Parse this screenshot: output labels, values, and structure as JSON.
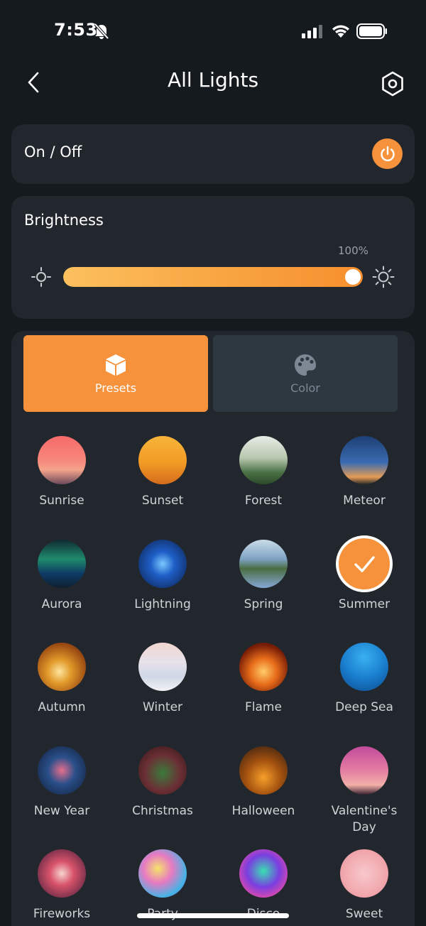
{
  "status": {
    "time": "7:53"
  },
  "nav": {
    "title": "All Lights"
  },
  "power": {
    "label": "On / Off"
  },
  "brightness": {
    "title": "Brightness",
    "percent_label": "100%",
    "level": 1.0
  },
  "tabs": [
    {
      "label": "Presets",
      "active": true
    },
    {
      "label": "Color",
      "active": false
    }
  ],
  "scenes": [
    {
      "label": "Sunrise",
      "bg": "linear-gradient(180deg,#f66b6b 0%,#f7877c 50%,#f4a48a 70%,#6b4a5b 100%)"
    },
    {
      "label": "Sunset",
      "bg": "linear-gradient(180deg,#f6b53a 0%,#f29b25 55%,#d56c1c 100%)"
    },
    {
      "label": "Forest",
      "bg": "linear-gradient(180deg,#e7ece6 0%,#b9c8b0 45%,#4c7246 75%,#2c4a2a 100%)"
    },
    {
      "label": "Meteor",
      "bg": "linear-gradient(180deg,#1e3f74 0%,#3a6bb1 55%,#e59b55 85%,#2a2a2a 100%)"
    },
    {
      "label": "Aurora",
      "bg": "linear-gradient(180deg,#0f2b33 0%,#1f8a6c 40%,#0d3a64 70%,#102030 100%)"
    },
    {
      "label": "Lightning",
      "bg": "radial-gradient(circle,#7ac9ff 0%,#1f5fc8 35%,#0b1c44 100%)"
    },
    {
      "label": "Spring",
      "bg": "linear-gradient(180deg,#c9dbe8 0%,#7fa3c4 40%,#4a6d42 60%,#86a8d8 100%)"
    },
    {
      "label": "Summer",
      "bg": "#f7923c",
      "selected": true
    },
    {
      "label": "Autumn",
      "bg": "radial-gradient(circle at 45% 60%,#fde6a0 0%,#e29a2a 30%,#9a4a12 70%,#3f2208 100%)"
    },
    {
      "label": "Winter",
      "bg": "linear-gradient(180deg,#f2d6d0 0%,#e7e1ea 40%,#cfd8e6 70%,#f2f2f5 100%)"
    },
    {
      "label": "Flame",
      "bg": "radial-gradient(circle at 50% 60%,#ffcb6a 0%,#e86d1a 35%,#7a1f08 70%,#2a0c05 100%)"
    },
    {
      "label": "Deep Sea",
      "bg": "radial-gradient(circle at 50% 30%,#39b1f0 0%,#1a7fcf 50%,#0c4a8e 100%)"
    },
    {
      "label": "New Year",
      "bg": "radial-gradient(circle,#e76f8d 0%,#2a4f8a 40%,#0e1c33 100%)"
    },
    {
      "label": "Christmas",
      "bg": "radial-gradient(circle at 50% 55%,#3c7a3d 0%,#6b2f34 50%,#2c1416 100%)"
    },
    {
      "label": "Halloween",
      "bg": "radial-gradient(circle at 50% 65%,#f79f2a 0%,#a1500f 45%,#2a1a12 100%)"
    },
    {
      "label": "Valentine's Day",
      "bg": "linear-gradient(180deg,#c24a9c 0%,#e37ea3 50%,#f3b0a8 80%,#3a2030 100%)"
    },
    {
      "label": "Fireworks",
      "bg": "radial-gradient(circle,#f5d4d0 0%,#d9536b 35%,#3b1a36 100%)"
    },
    {
      "label": "Party",
      "bg": "radial-gradient(circle at 40% 40%,#f6e36a 0%,#e77ac2 35%,#44b4e6 70%,#7a46c9 100%)"
    },
    {
      "label": "Disco",
      "bg": "radial-gradient(circle at 50% 45%,#38e0b2 0%,#7a3ee0 45%,#e64aa8 80%,#2a1133 100%)"
    },
    {
      "label": "Sweet",
      "bg": "radial-gradient(circle,#f8c8cc 0%,#f1a9ae 60%,#e78a96 100%)"
    }
  ]
}
